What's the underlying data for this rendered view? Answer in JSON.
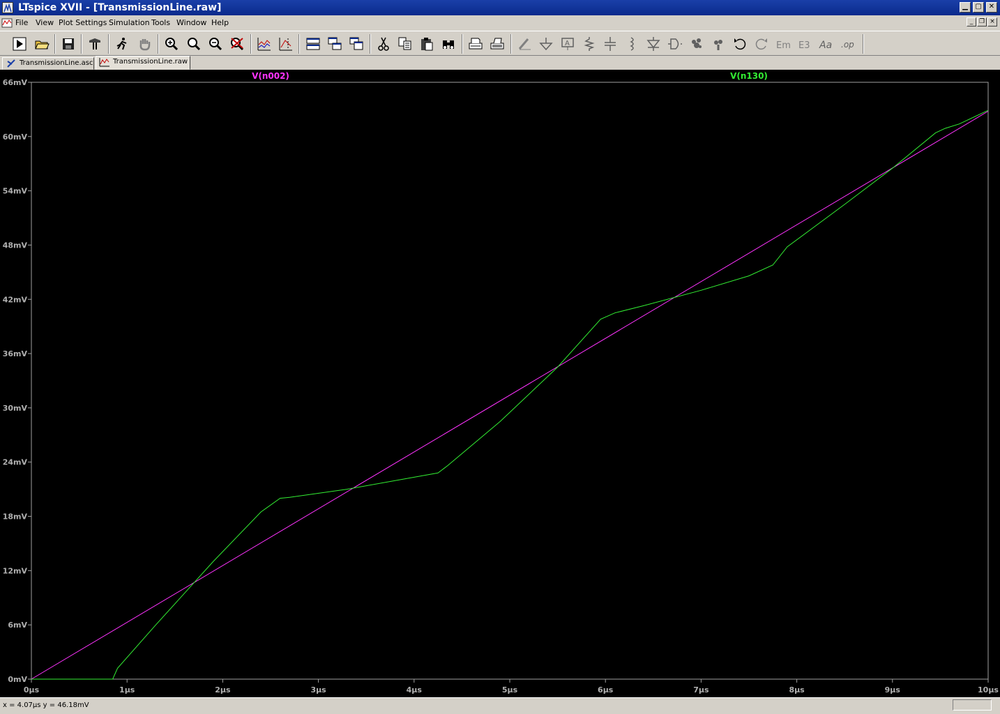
{
  "window": {
    "title": "LTspice XVII - [TransmissionLine.raw]",
    "minimize": "▁",
    "maximize": "▢",
    "close": "✕"
  },
  "menu": {
    "items": [
      {
        "label": "File"
      },
      {
        "label": "View"
      },
      {
        "label": "Plot Settings"
      },
      {
        "label": "Simulation"
      },
      {
        "label": "Tools"
      },
      {
        "label": "Window"
      },
      {
        "label": "Help"
      }
    ]
  },
  "toolbar": {
    "icons": [
      "run-icon",
      "open-icon",
      "save-icon",
      "control-panel-icon",
      "probe-icon",
      "pan-hand-icon",
      "zoom-in-icon",
      "zoom-out-icon",
      "zoom-fit-icon",
      "zoom-cancel-icon",
      "autorange-icon",
      "delete-trace-icon",
      "tile-horizontal-icon",
      "cascade-icon",
      "tile-vertical-icon",
      "cut-icon",
      "copy-icon",
      "paste-icon",
      "find-icon",
      "print-preview-icon",
      "print-icon",
      "wire-icon",
      "ground-icon",
      "label-icon",
      "resistor-icon",
      "capacitor-icon",
      "inductor-icon",
      "diode-icon",
      "component-icon",
      "rotate-icon",
      "mirror-icon",
      "undo-icon",
      "redo-icon",
      "text-icon",
      "spice-directive-icon",
      "op-icon"
    ]
  },
  "tabs": [
    {
      "label": "TransmissionLine.asc",
      "active": false
    },
    {
      "label": "TransmissionLine.raw",
      "active": true
    }
  ],
  "status": {
    "text": "x = 4.07µs    y = 46.18mV"
  },
  "chart_data": {
    "type": "line",
    "title": "",
    "xlabel": "",
    "ylabel": "",
    "xlim": [
      0,
      10
    ],
    "ylim": [
      0,
      66
    ],
    "x_ticks": [
      "0µs",
      "1µs",
      "2µs",
      "3µs",
      "4µs",
      "5µs",
      "6µs",
      "7µs",
      "8µs",
      "9µs",
      "10µs"
    ],
    "y_ticks": [
      "0mV",
      "6mV",
      "12mV",
      "18mV",
      "24mV",
      "30mV",
      "36mV",
      "42mV",
      "48mV",
      "54mV",
      "60mV",
      "66mV"
    ],
    "grid": false,
    "series": [
      {
        "name": "V(n002)",
        "color": "#ff33ff",
        "x": [
          0,
          10
        ],
        "y": [
          0,
          62.8
        ]
      },
      {
        "name": "V(n130)",
        "color": "#33ee33",
        "x": [
          0,
          0.85,
          0.9,
          1.3,
          1.9,
          2.4,
          2.6,
          2.7,
          3.3,
          4.25,
          4.35,
          4.9,
          5.5,
          5.95,
          6.1,
          6.4,
          7.0,
          7.5,
          7.75,
          7.9,
          8.5,
          9.0,
          9.45,
          9.55,
          9.7,
          10.0
        ],
        "y": [
          0,
          0,
          1.2,
          6,
          13,
          18.5,
          20,
          20.1,
          21.0,
          22.8,
          23.6,
          28.5,
          34.5,
          39.8,
          40.5,
          41.3,
          43.0,
          44.6,
          45.8,
          47.8,
          52.5,
          56.5,
          60.4,
          60.9,
          61.4,
          62.9
        ]
      }
    ]
  }
}
